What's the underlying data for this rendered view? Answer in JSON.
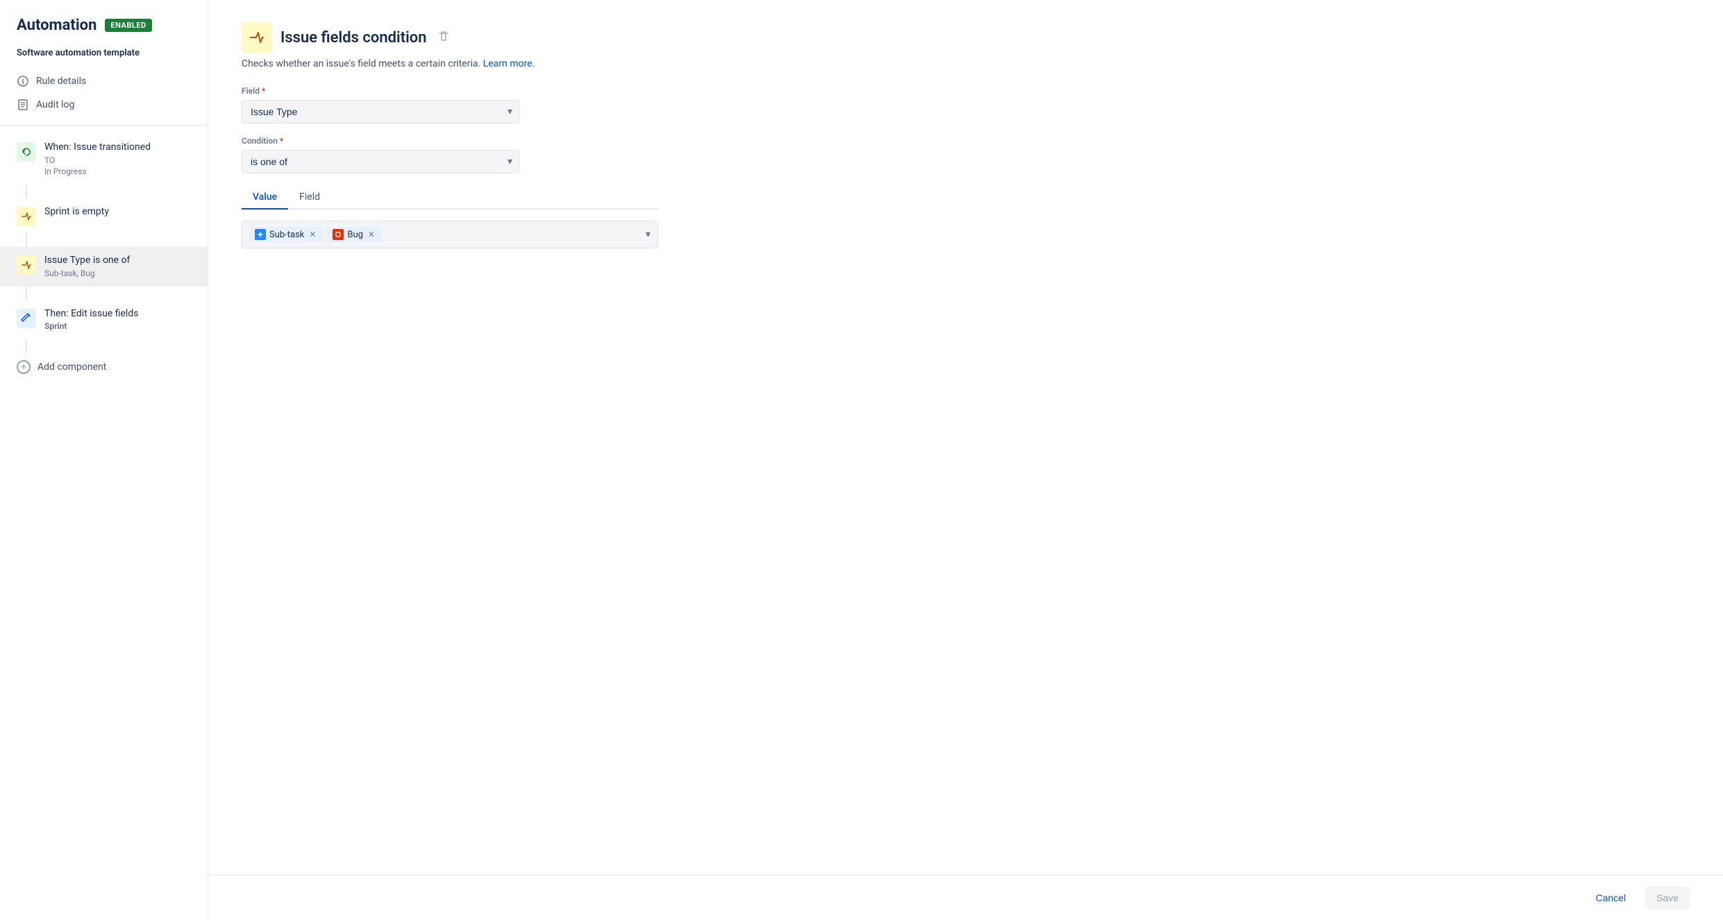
{
  "header": {
    "title": "Automation",
    "badge": "ENABLED"
  },
  "sidebar": {
    "subtitle": "Software automation template",
    "nav_items": [
      {
        "id": "rule-details",
        "label": "Rule details",
        "icon": "ℹ"
      },
      {
        "id": "audit-log",
        "label": "Audit log",
        "icon": "📋"
      }
    ],
    "steps": [
      {
        "id": "when-trigger",
        "icon_type": "green",
        "icon": "↩",
        "title": "When: Issue transitioned",
        "sub1": "TO",
        "sub2": "In Progress"
      },
      {
        "id": "sprint-condition",
        "icon_type": "yellow",
        "icon": "⇄",
        "title": "Sprint is empty",
        "sub1": "",
        "sub2": ""
      },
      {
        "id": "issue-type-condition",
        "icon_type": "yellow",
        "icon": "⇄",
        "title": "Issue Type is one of",
        "sub1": "Sub-task, Bug",
        "sub2": "",
        "active": true
      },
      {
        "id": "then-action",
        "icon_type": "blue",
        "icon": "✏",
        "title": "Then: Edit issue fields",
        "sub1": "Sprint",
        "sub2": "",
        "title_bold": true
      }
    ],
    "add_component": "Add component"
  },
  "main": {
    "icon": "⇄",
    "title": "Issue fields condition",
    "description": "Checks whether an issue's field meets a certain criteria.",
    "learn_more": "Learn more.",
    "field_label": "Field",
    "field_value": "Issue Type",
    "condition_label": "Condition",
    "condition_value": "is one of",
    "tabs": [
      {
        "id": "value",
        "label": "Value",
        "active": true
      },
      {
        "id": "field",
        "label": "Field",
        "active": false
      }
    ],
    "tags": [
      {
        "id": "subtask",
        "label": "Sub-task",
        "icon_type": "blue",
        "icon_letter": "S"
      },
      {
        "id": "bug",
        "label": "Bug",
        "icon_type": "red",
        "icon_letter": "B"
      }
    ]
  },
  "footer": {
    "cancel_label": "Cancel",
    "save_label": "Save"
  }
}
